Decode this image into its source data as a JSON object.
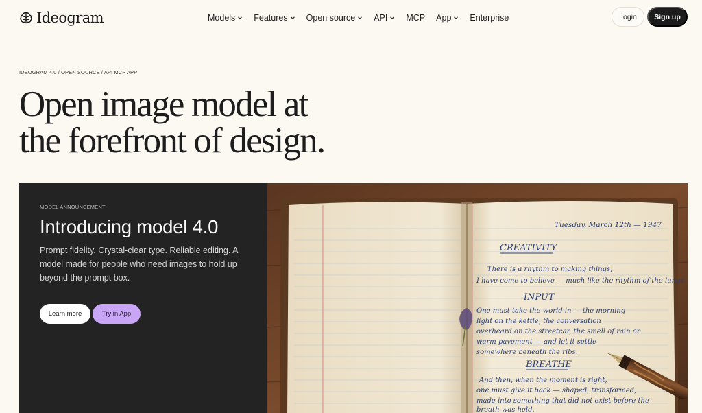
{
  "brand": {
    "name": "Ideogram"
  },
  "nav": {
    "items": [
      {
        "label": "Models",
        "dropdown": true
      },
      {
        "label": "Features",
        "dropdown": true
      },
      {
        "label": "Open source",
        "dropdown": true
      },
      {
        "label": "API",
        "dropdown": true
      },
      {
        "label": "MCP",
        "dropdown": false
      },
      {
        "label": "App",
        "dropdown": true
      },
      {
        "label": "Enterprise",
        "dropdown": false
      }
    ],
    "login_label": "Login",
    "signup_label": "Sign up"
  },
  "hero": {
    "breadcrumb": "IDEOGRAM 4.0 / OPEN SOURCE / API MCP APP",
    "headline_line1": "Open image model at",
    "headline_line2": "the forefront of design."
  },
  "feature": {
    "eyebrow": "MODEL ANNOUNCEMENT",
    "title": "Introducing model 4.0",
    "description": "Prompt fidelity. Crystal-clear type. Reliable editing. A model made for people who need images to hold up beyond the prompt box.",
    "learn_more_label": "Learn more",
    "try_label": "Try in App"
  },
  "notebook": {
    "date": "Tuesday, March 12th — 1947",
    "heading1": "CREATIVITY",
    "para1_line1": "There is a rhythm to making things,",
    "para1_line2": "I have come to believe — much like the rhythm of the lungs.",
    "heading2": "INPUT",
    "para2_line1": "One must take the world in — the morning",
    "para2_line2": "light on the kettle, the conversation",
    "para2_line3": "overheard on the streetcar, the smell of rain on",
    "para2_line4": "warm pavement — and let it settle",
    "para2_line5": "somewhere beneath the ribs.",
    "heading3": "BREATHE",
    "para3_line1": "And then, when the moment is right,",
    "para3_line2": "one must give it back — shaped, transformed,",
    "para3_line3": "made into something that did not exist before the",
    "para3_line4": "breath was held."
  },
  "colors": {
    "background": "#fcf8f2",
    "dark_panel": "#232324",
    "accent_purple": "#c9a6f5",
    "ink": "#2c3f72"
  },
  "icons": [
    "ideogram-logo-icon",
    "chevron-down-icon"
  ]
}
